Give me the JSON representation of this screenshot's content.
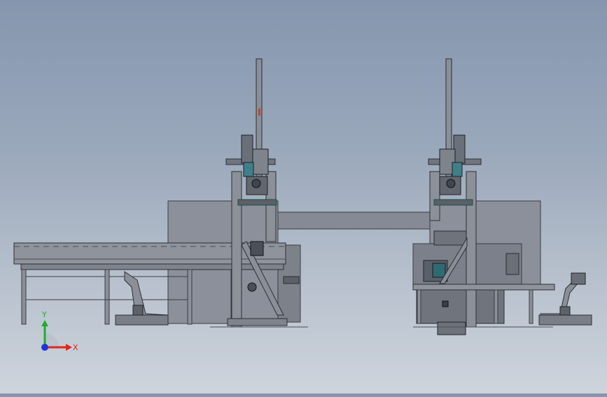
{
  "viewport": {
    "background_top": "#8596ae",
    "background_bottom": "#cdd4dc"
  },
  "triad": {
    "y_label": "Y",
    "x_label": "X",
    "y_color": "#1fae2e",
    "x_color": "#e0261d",
    "z_color": "#1f36d6"
  }
}
